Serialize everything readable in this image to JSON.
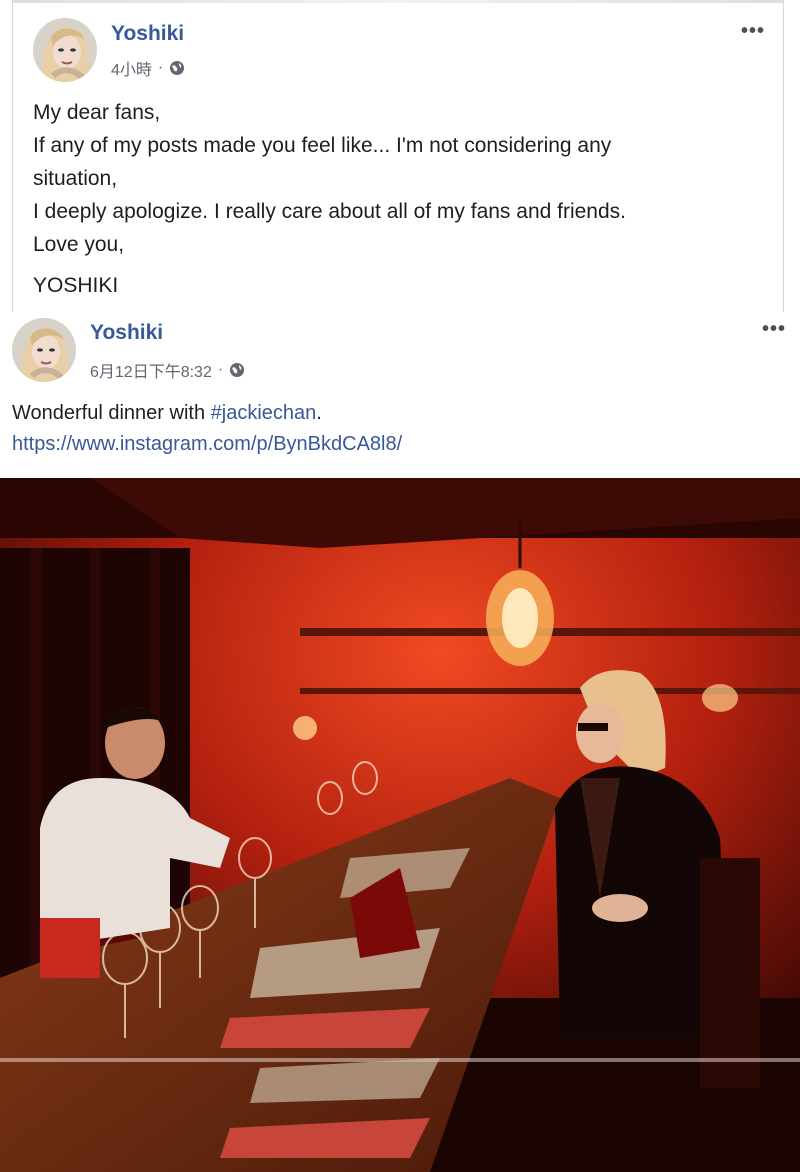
{
  "post1": {
    "author": "Yoshiki",
    "time": "4小時",
    "separator": "·",
    "lines": [
      "My dear fans,",
      "If any of my posts made you feel like... I'm not considering any",
      "situation,",
      "I deeply apologize. I really care about all of my fans and friends.",
      "Love you,"
    ],
    "signature": "YOSHIKI",
    "more_label": "•••"
  },
  "post2": {
    "author": "Yoshiki",
    "time": "6月12日下午8:32",
    "separator": "·",
    "text_prefix": "Wonderful dinner with ",
    "hashtag": "#jackiechan",
    "text_suffix": ".",
    "link": "https://www.instagram.com/p/BynBkdCA8l8/",
    "more_label": "•••"
  },
  "icons": {
    "privacy": "globe-icon",
    "menu": "more-options-icon"
  },
  "colors": {
    "name_blue": "#385898",
    "meta_gray": "#606770",
    "text": "#1c1e21",
    "photo_red": "#c0200e"
  }
}
